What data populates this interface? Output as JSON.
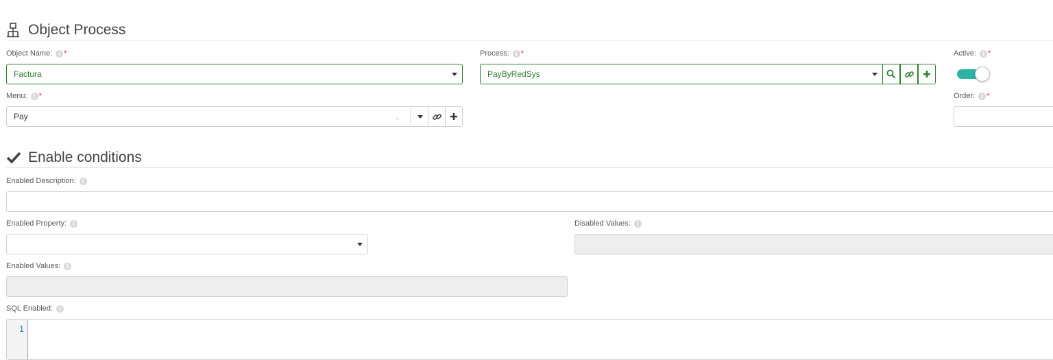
{
  "sections": {
    "object_process": {
      "title": "Object Process",
      "icon": "sitemap-icon"
    },
    "enable_conditions": {
      "title": "Enable conditions",
      "icon": "checkmark-icon"
    }
  },
  "fields": {
    "object_name": {
      "label": "Object Name:",
      "required": "*",
      "value": "Factura"
    },
    "process": {
      "label": "Process:",
      "required": "*",
      "value": "PayByRedSys"
    },
    "active": {
      "label": "Active:",
      "required": "*",
      "value": "on"
    },
    "menu": {
      "label": "Menu:",
      "required": "*",
      "value": "Pay",
      "trailing": ".."
    },
    "order": {
      "label": "Order:",
      "required": "*",
      "value": ""
    },
    "enabled_description": {
      "label": "Enabled Description:",
      "value": ""
    },
    "enabled_property": {
      "label": "Enabled Property:",
      "value": ""
    },
    "disabled_values": {
      "label": "Disabled Values:",
      "value": ""
    },
    "enabled_values": {
      "label": "Enabled Values:",
      "value": ""
    },
    "sql_enabled": {
      "label": "SQL Enabled:",
      "line_number": "1"
    }
  },
  "info_glyph": "i",
  "colors": {
    "accent_green": "#2f7d2f",
    "toggle_on": "#2bb3a3",
    "required": "#c0392b"
  }
}
